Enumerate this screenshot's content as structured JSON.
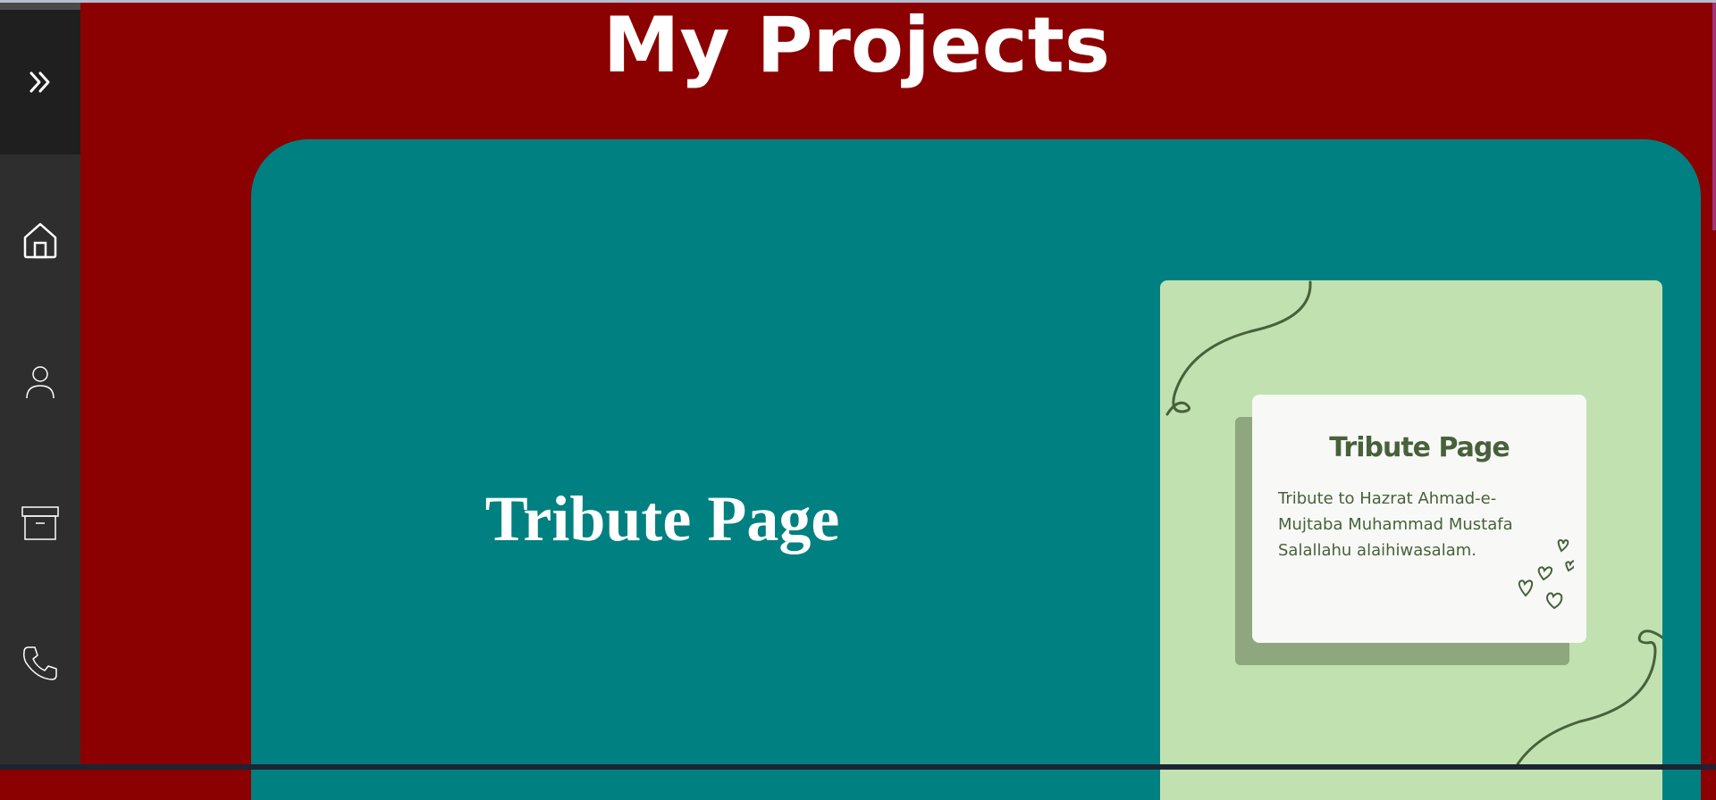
{
  "page": {
    "title": "My Projects"
  },
  "sidebar": {
    "toggle_icon": "double-chevron-right-icon",
    "items": [
      {
        "id": "home",
        "icon": "home-icon"
      },
      {
        "id": "about",
        "icon": "user-icon"
      },
      {
        "id": "projects",
        "icon": "archive-icon"
      },
      {
        "id": "contact",
        "icon": "phone-icon"
      }
    ]
  },
  "project": {
    "name": "Tribute Page",
    "preview": {
      "title": "Tribute Page",
      "description": "Tribute to Hazrat Ahmad-e-Mujtaba Muhammad Mustafa Salallahu alaihiwasalam."
    }
  },
  "colors": {
    "background": "#8b0000",
    "sidebar": "#2e2e2e",
    "card": "#008080",
    "preview_bg": "#c1e1b0",
    "preview_accent": "#47613a"
  }
}
